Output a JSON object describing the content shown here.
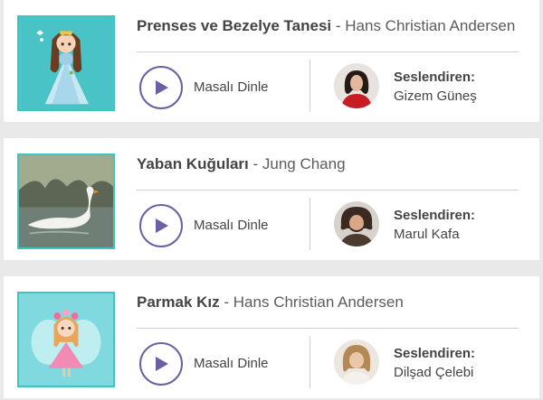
{
  "stories": [
    {
      "title": "Prenses ve Bezelye Tanesi",
      "separator": " - ",
      "author": "Hans Christian Andersen",
      "listen_label": "Masalı Dinle",
      "narrator_label": "Seslendiren:",
      "narrator_name": "Gizem Güneş",
      "cover_icon": "princess-illustration",
      "avatar_icon": "narrator-portrait"
    },
    {
      "title": "Yaban Kuğuları",
      "separator": " - ",
      "author": "Jung Chang",
      "listen_label": "Masalı Dinle",
      "narrator_label": "Seslendiren:",
      "narrator_name": "Marul Kafa",
      "cover_icon": "swan-illustration",
      "avatar_icon": "narrator-portrait"
    },
    {
      "title": "Parmak Kız",
      "separator": " - ",
      "author": "Hans Christian Andersen",
      "listen_label": "Masalı Dinle",
      "narrator_label": "Seslendiren:",
      "narrator_name": "Dilşad Çelebi",
      "cover_icon": "fairy-illustration",
      "avatar_icon": "narrator-portrait"
    }
  ],
  "colors": {
    "accent": "#6d5fa3",
    "cover_border": "#3fc4c0",
    "background": "#e9e9ea"
  }
}
